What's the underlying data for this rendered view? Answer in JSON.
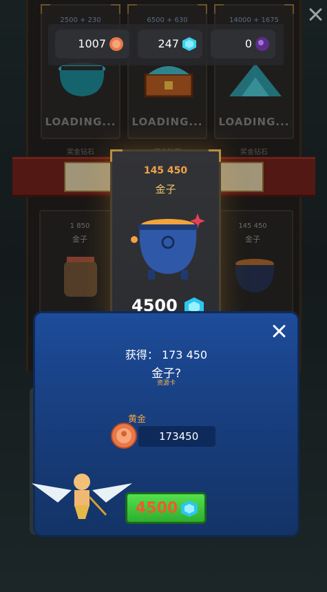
{
  "shop": {
    "packs_top": [
      {
        "amount_top": "2500 + 230",
        "status": "LOADING...",
        "caption": "奖金钻石"
      },
      {
        "amount_top": "6500 + 630",
        "status": "LOADING...",
        "caption": "奖金钻石"
      },
      {
        "amount_top": "14000 + 1675",
        "status": "LOADING...",
        "caption": "奖金钻石"
      }
    ],
    "packs_bottom": [
      {
        "amount": "1 850",
        "label": "金子"
      },
      {
        "amount": "145 450",
        "label": "金子"
      }
    ]
  },
  "currency": {
    "coins": "1007",
    "gems": "247",
    "orbs": "0"
  },
  "offer": {
    "amount": "145 450",
    "title": "金子",
    "price": "4500"
  },
  "reward": {
    "obtained": "获得： 173 450",
    "item_name": "金子?",
    "item_sub": "资源卡",
    "gold_label": "黄金",
    "gold_value": "173450",
    "buy_price": "4500"
  },
  "colors": {
    "panel_blue": "#1d4c9a",
    "buy_green": "#54e04e",
    "price_orange": "#ee5b2b",
    "gold_text": "#f0a24a"
  },
  "icons": [
    "coin-icon",
    "gem-icon",
    "orb-icon",
    "close-icon",
    "cauldron-icon",
    "cupid-icon"
  ]
}
